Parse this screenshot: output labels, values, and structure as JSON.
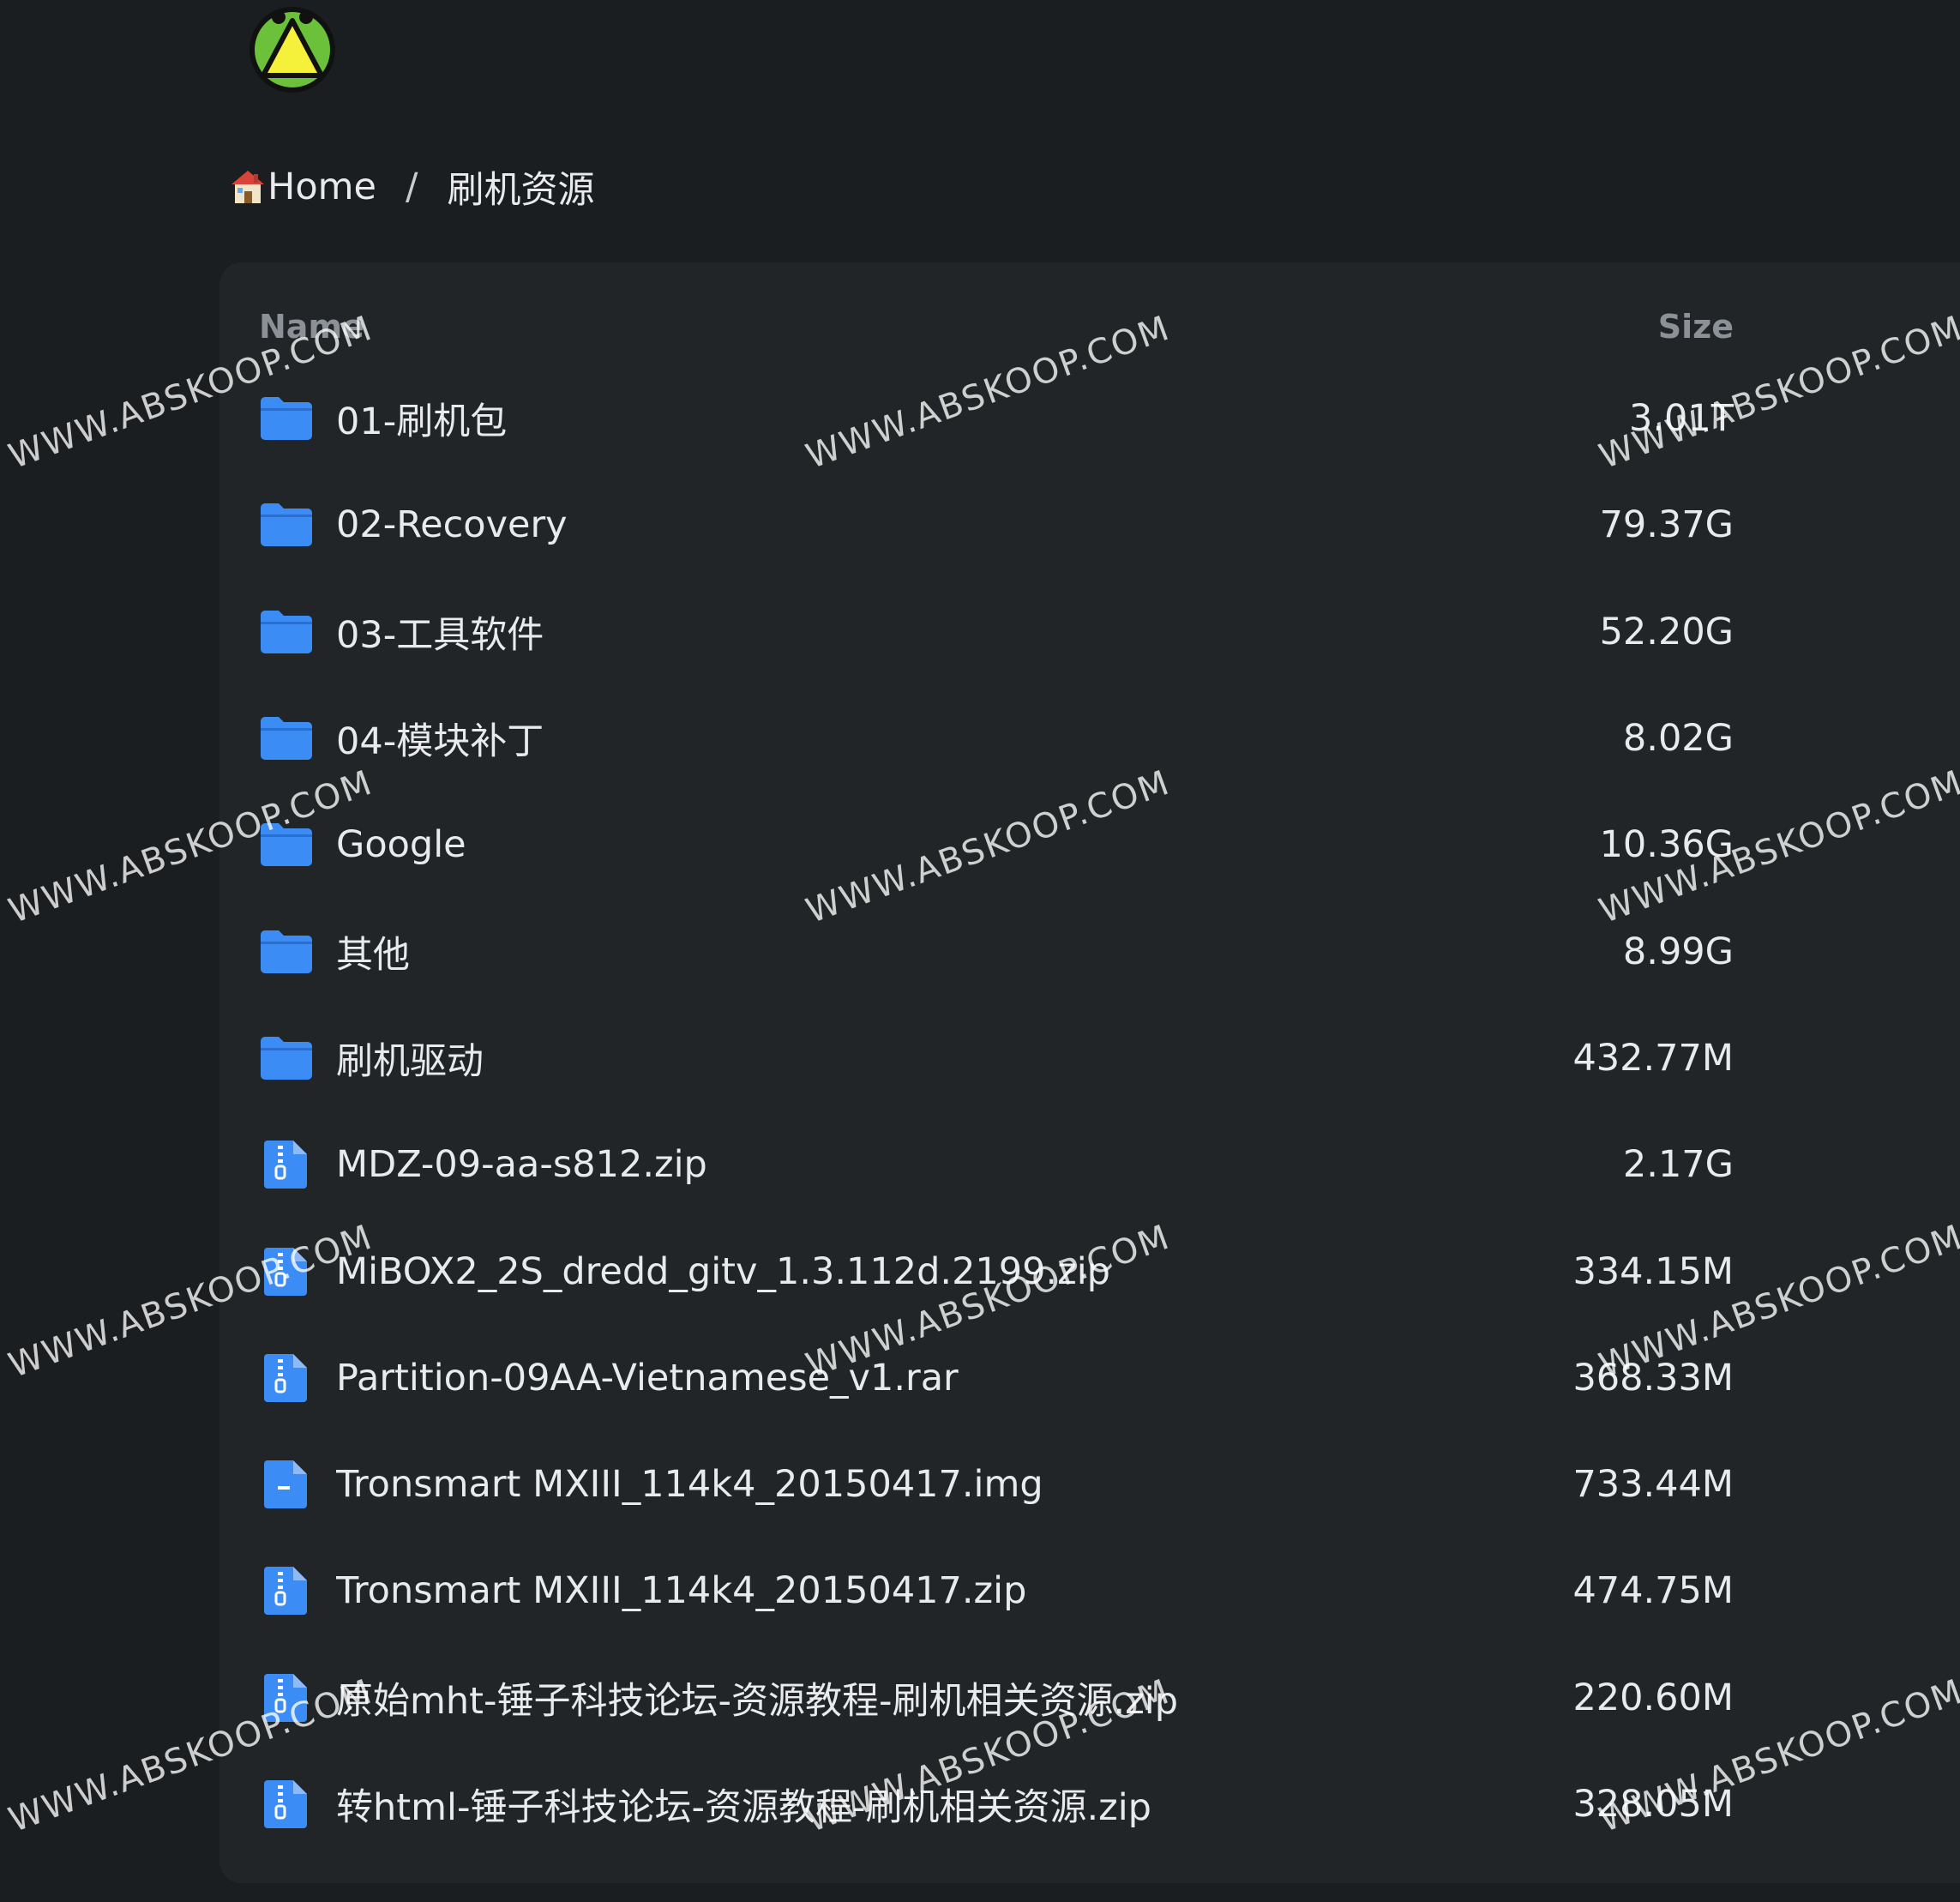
{
  "breadcrumb": {
    "home_label": "Home",
    "separator": "/",
    "current": "刷机资源"
  },
  "list": {
    "header_name": "Name",
    "header_size": "Size",
    "items": [
      {
        "type": "folder",
        "name": "01-刷机包",
        "size": "3.01T"
      },
      {
        "type": "folder",
        "name": "02-Recovery",
        "size": "79.37G"
      },
      {
        "type": "folder",
        "name": "03-工具软件",
        "size": "52.20G"
      },
      {
        "type": "folder",
        "name": "04-模块补丁",
        "size": "8.02G"
      },
      {
        "type": "folder",
        "name": "Google",
        "size": "10.36G"
      },
      {
        "type": "folder",
        "name": "其他",
        "size": "8.99G"
      },
      {
        "type": "folder",
        "name": "刷机驱动",
        "size": "432.77M"
      },
      {
        "type": "archive",
        "name": "MDZ-09-aa-s812.zip",
        "size": "2.17G"
      },
      {
        "type": "archive",
        "name": "MiBOX2_2S_dredd_gitv_1.3.112d.2199.zip",
        "size": "334.15M"
      },
      {
        "type": "archive",
        "name": "Partition-09AA-Vietnamese_v1.rar",
        "size": "368.33M"
      },
      {
        "type": "file",
        "name": "Tronsmart MXIII_114k4_20150417.img",
        "size": "733.44M"
      },
      {
        "type": "archive",
        "name": "Tronsmart MXIII_114k4_20150417.zip",
        "size": "474.75M"
      },
      {
        "type": "archive",
        "name": "原始mht-锤子科技论坛-资源教程-刷机相关资源.zip",
        "size": "220.60M"
      },
      {
        "type": "archive",
        "name": "转html-锤子科技论坛-资源教程-刷机相关资源.zip",
        "size": "328.05M"
      }
    ]
  },
  "icons": {
    "folder": "folder-icon",
    "archive": "zip-file-icon",
    "file": "file-icon",
    "home": "house-icon",
    "logo": "bug-logo-icon"
  },
  "colors": {
    "background": "#1b1e20",
    "card": "#212527",
    "accent_blue": "#3b8cf5",
    "text": "#e8eaed",
    "header_text": "#8b9196"
  },
  "watermark": {
    "text": "WWW.ABSKOOP.COM"
  }
}
